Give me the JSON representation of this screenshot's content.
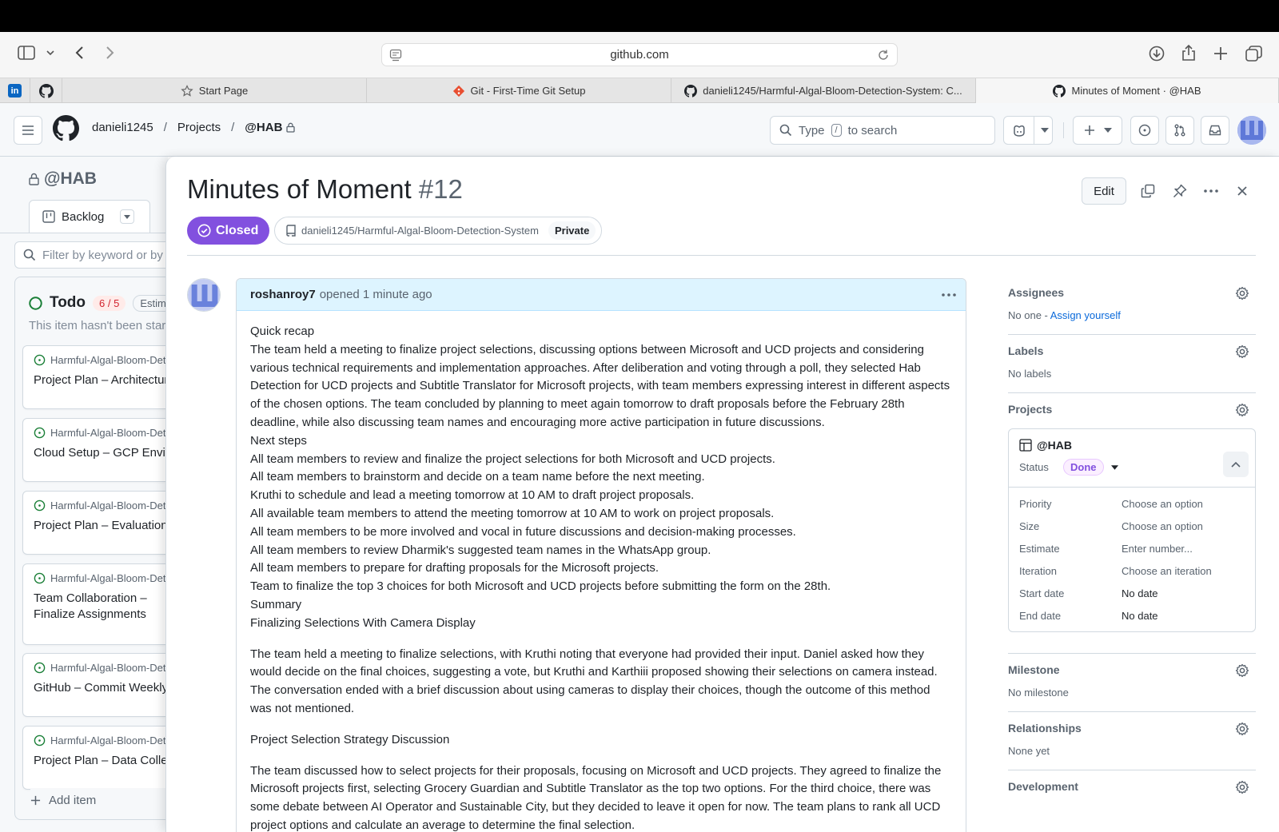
{
  "browser": {
    "url": "github.com",
    "tabs": [
      {
        "label": "Start Page"
      },
      {
        "label": "Git - First-Time Git Setup"
      },
      {
        "label": "danieli1245/Harmful-Algal-Bloom-Detection-System: C..."
      },
      {
        "label": "Minutes of Moment · @HAB"
      }
    ]
  },
  "header": {
    "owner": "danieli1245",
    "projects": "Projects",
    "project": "@HAB",
    "search_type": "Type",
    "search_slash": "/",
    "search_rest": "to search"
  },
  "board": {
    "project": "@HAB",
    "view_tab": "Backlog",
    "filter_placeholder": "Filter by keyword or by field",
    "column": {
      "name": "Todo",
      "count": "6 / 5",
      "estimate": "Estimate"
    },
    "column_desc": "This item hasn't been started",
    "cards": [
      {
        "repo": "Harmful-Algal-Bloom-Detection-System",
        "title": "Project Plan – Architecture"
      },
      {
        "repo": "Harmful-Algal-Bloom-Detection-System",
        "title": "Cloud Setup – GCP Environment"
      },
      {
        "repo": "Harmful-Algal-Bloom-Detection-System",
        "title": "Project Plan – Evaluation"
      },
      {
        "repo": "Harmful-Algal-Bloom-Detection-System",
        "title": "Team Collaboration – Finalize Assignments"
      },
      {
        "repo": "Harmful-Algal-Bloom-Detection-System",
        "title": "GitHub – Commit Weekly"
      },
      {
        "repo": "Harmful-Algal-Bloom-Detection-System",
        "title": "Project Plan – Data Collection"
      }
    ],
    "add_item": "Add item"
  },
  "issue": {
    "title": "Minutes of Moment",
    "number": "#12",
    "state": "Closed",
    "repo": "danieli1245/Harmful-Algal-Bloom-Detection-System",
    "visibility": "Private",
    "edit": "Edit",
    "author": "roshanroy7",
    "opened": "opened 1 minute ago",
    "body": {
      "lines": [
        "Quick recap",
        "The team held a meeting to finalize project selections, discussing options between Microsoft and UCD projects and considering various technical requirements and implementation approaches. After deliberation and voting through a poll, they selected Hab Detection for UCD projects and Subtitle Translator for Microsoft projects, with team members expressing interest in different aspects of the chosen options. The team concluded by planning to meet again tomorrow to draft proposals before the February 28th deadline, while also discussing team names and encouraging more active participation in future discussions.",
        "Next steps",
        "All team members to review and finalize the project selections for both Microsoft and UCD projects.",
        "All team members to brainstorm and decide on a team name before the next meeting.",
        "Kruthi to schedule and lead a meeting tomorrow at 10 AM to draft project proposals.",
        "All available team members to attend the meeting tomorrow at 10 AM to work on project proposals.",
        "All team members to be more involved and vocal in future discussions and decision-making processes.",
        "All team members to review Dharmik's suggested team names in the WhatsApp group.",
        "All team members to prepare for drafting proposals for the Microsoft projects.",
        "Team to finalize the top 3 choices for both Microsoft and UCD projects before submitting the form on the 28th.",
        "Summary",
        "Finalizing Selections With Camera Display"
      ],
      "para2": "The team held a meeting to finalize selections, with Kruthi noting that everyone had provided their input. Daniel asked how they would decide on the final choices, suggesting a vote, but Kruthi and Karthiii proposed showing their selections on camera instead. The conversation ended with a brief discussion about using cameras to display their choices, though the outcome of this method was not mentioned.",
      "heading3": "Project Selection Strategy Discussion",
      "para3": "The team discussed how to select projects for their proposals, focusing on Microsoft and UCD projects. They agreed to finalize the Microsoft projects first, selecting Grocery Guardian and Subtitle Translator as the top two options. For the third choice, there was some debate between AI Operator and Sustainable City, but they decided to leave it open for now. The team plans to rank all UCD project options and calculate an average to determine the final selection."
    }
  },
  "sidebar": {
    "assignees": {
      "label": "Assignees",
      "value": "No one - ",
      "link": "Assign yourself"
    },
    "labels": {
      "label": "Labels",
      "value": "No labels"
    },
    "projects": {
      "label": "Projects",
      "name": "@HAB",
      "status_label": "Status",
      "status_value": "Done",
      "fields": [
        {
          "key": "Priority",
          "value": "Choose an option"
        },
        {
          "key": "Size",
          "value": "Choose an option"
        },
        {
          "key": "Estimate",
          "value": "Enter number..."
        },
        {
          "key": "Iteration",
          "value": "Choose an iteration"
        },
        {
          "key": "Start date",
          "value": "No date"
        },
        {
          "key": "End date",
          "value": "No date"
        }
      ]
    },
    "milestone": {
      "label": "Milestone",
      "value": "No milestone"
    },
    "relationships": {
      "label": "Relationships",
      "value": "None yet"
    },
    "development": {
      "label": "Development"
    }
  },
  "colors": {
    "closed": "#8250df",
    "link": "#0969da",
    "done_bg": "#fbefff",
    "done_fg": "#8250df",
    "count": "#d1242f"
  }
}
